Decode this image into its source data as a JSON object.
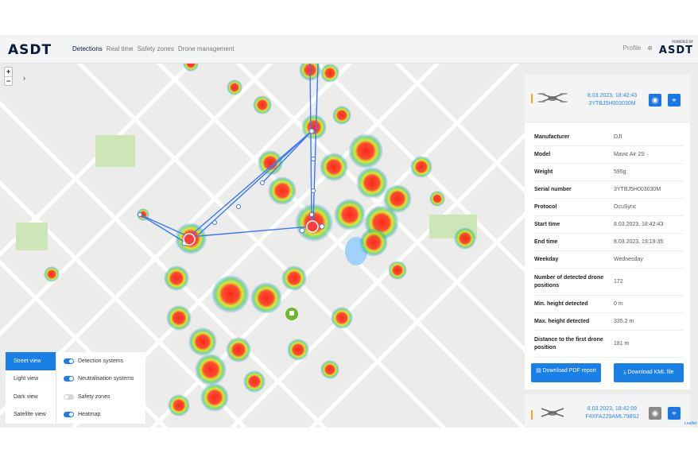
{
  "app": {
    "logo": "ASDT"
  },
  "nav": {
    "links": [
      "Detections",
      "Real time",
      "Safety zones",
      "Drone management"
    ],
    "profile": "Profile",
    "brand": "ASDT",
    "powered_by": "POWERED BY"
  },
  "map": {
    "zoom_in": "+",
    "zoom_out": "−",
    "expand": "›",
    "attribution": "Leaflet"
  },
  "detection": {
    "datetime": "8.03.2023, 18:42:43",
    "serial": "3YTBJ5H003030M",
    "details": [
      {
        "key": "Manufacturer",
        "value": "DJI"
      },
      {
        "key": "Model",
        "value": "Mavic Air 2S"
      },
      {
        "key": "Weight",
        "value": "595g"
      },
      {
        "key": "Serial number",
        "value": "3YTBJ5H003030M"
      },
      {
        "key": "Protocol",
        "value": "OcuSync"
      },
      {
        "key": "Start time",
        "value": "8.03.2023, 18:42:43"
      },
      {
        "key": "End time",
        "value": "8.03.2023, 19:19:35"
      },
      {
        "key": "Weekday",
        "value": "Wednesday"
      },
      {
        "key": "Number of detected drone positions",
        "value": "172"
      },
      {
        "key": "Min. height detected",
        "value": "0 m"
      },
      {
        "key": "Max. height detected",
        "value": "335.2 m"
      },
      {
        "key": "Distance to the first drone position",
        "value": "181 m"
      }
    ],
    "download_pdf": "Download PDF report",
    "download_kml": "Download KML file"
  },
  "detection2": {
    "datetime": "8.03.2023, 18:42:09",
    "serial": "F4XFA229AML798SJ"
  },
  "controls": {
    "views": [
      "Street view",
      "Light view",
      "Dark view",
      "Satellite view"
    ],
    "selected_view": "Street view",
    "toggles": [
      {
        "label": "Detection systems",
        "on": true
      },
      {
        "label": "Neutralisation systems",
        "on": true
      },
      {
        "label": "Safety zones",
        "on": false
      },
      {
        "label": "Heatmap",
        "on": true
      }
    ]
  },
  "colors": {
    "accent": "#1a7fe6",
    "warning": "#f5a623"
  }
}
